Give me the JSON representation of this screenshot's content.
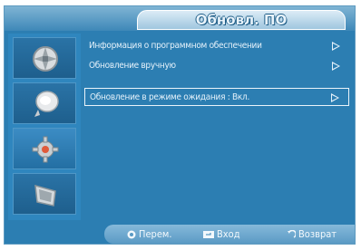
{
  "screen": {
    "title": "Обновл. ПО",
    "colors": {
      "background": "#2c7eb2",
      "title_tab": "#cfe4f2",
      "text": "#e4f1fa",
      "help_bar": "#6fa9cf"
    }
  },
  "sidebar": {
    "items": [
      {
        "icon": "picture-icon",
        "active": false
      },
      {
        "icon": "sound-icon",
        "active": false
      },
      {
        "icon": "setup-gear-icon",
        "active": true
      },
      {
        "icon": "input-icon",
        "active": false
      }
    ]
  },
  "menu": {
    "items": [
      {
        "label": "Информация о программном обеспечении",
        "selected": false
      },
      {
        "label": "Обновление вручную",
        "selected": false
      },
      {
        "label": "Обновление в режиме ожидания : Вкл.",
        "selected": true
      }
    ]
  },
  "help": {
    "move_label": "Перем.",
    "enter_label": "Вход",
    "return_label": "Возврат"
  }
}
